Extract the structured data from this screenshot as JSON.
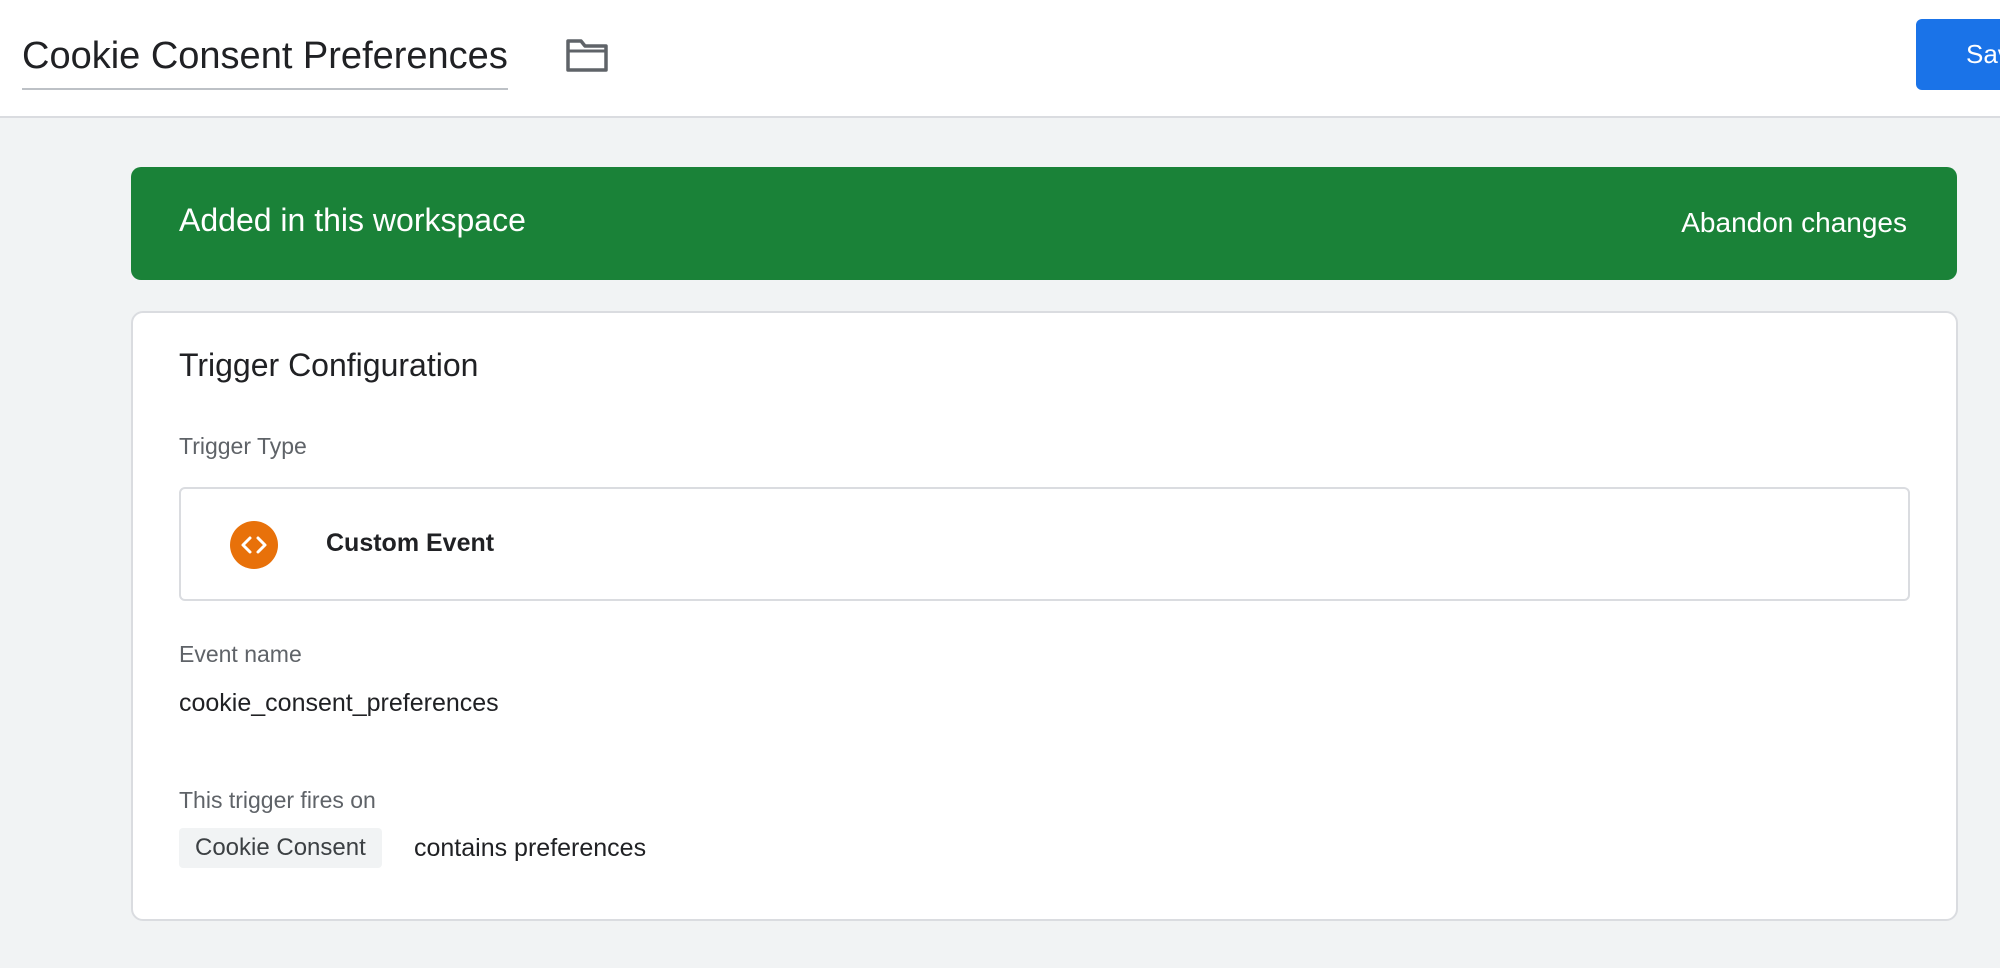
{
  "header": {
    "title": "Cookie Consent Preferences",
    "folder_icon": "folder-icon",
    "save_label": "Save"
  },
  "banner": {
    "text": "Added in this workspace",
    "abandon_label": "Abandon changes",
    "color": "#1a8238"
  },
  "trigger": {
    "section_title": "Trigger Configuration",
    "type_label": "Trigger Type",
    "type_name": "Custom Event",
    "type_icon": "code-brackets-icon",
    "type_icon_color": "#e8710a",
    "event_name_label": "Event name",
    "event_name_value": "cookie_consent_preferences",
    "fires_on_label": "This trigger fires on",
    "condition_variable": "Cookie Consent",
    "condition_text": "contains preferences"
  },
  "colors": {
    "accent": "#1a73e8",
    "background": "#f1f3f4"
  }
}
